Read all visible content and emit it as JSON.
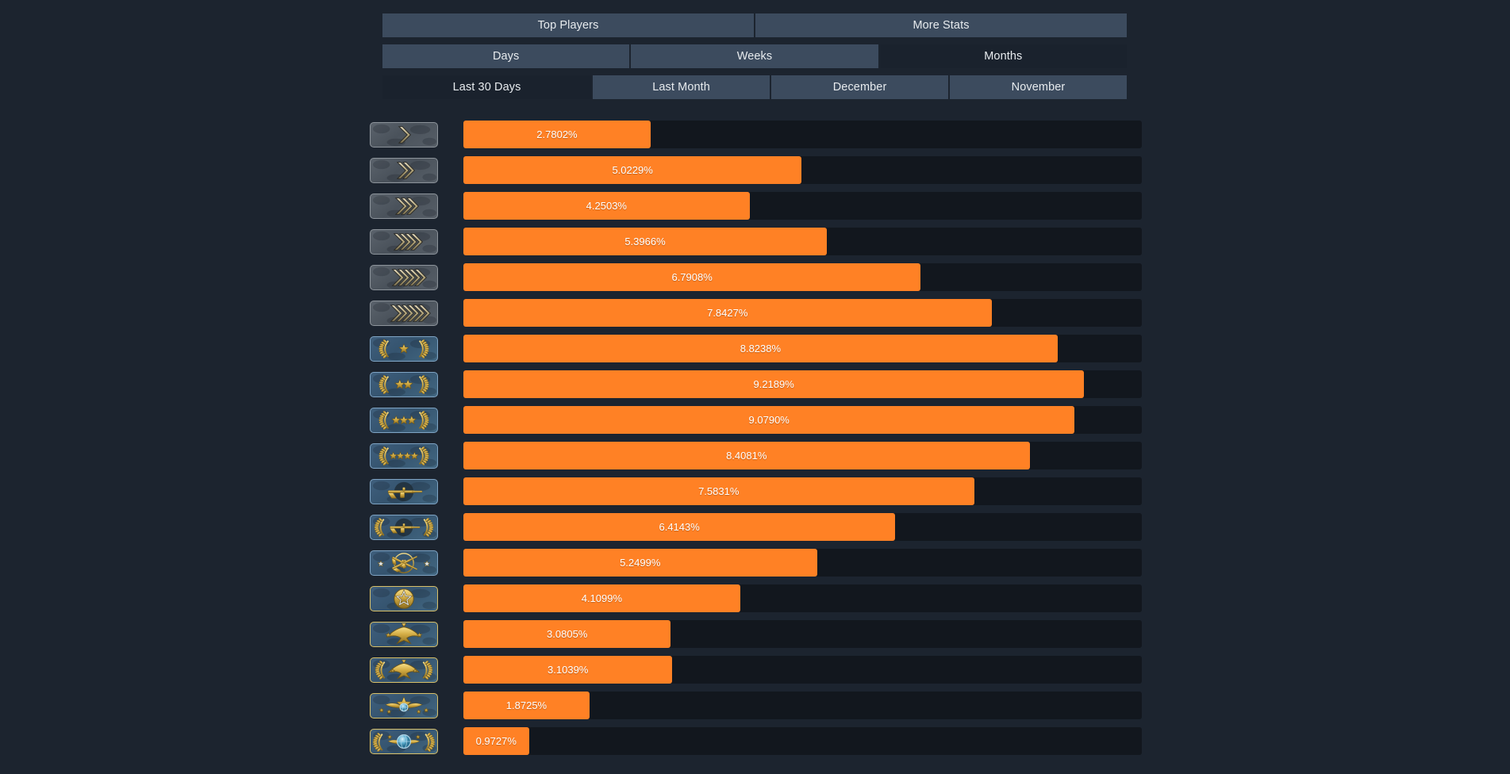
{
  "theme": {
    "page_background": "#1c242f",
    "tab_background": "#3c4b5e",
    "tab_active_background": "#1a222d",
    "track_background": "#12171e",
    "bar_color": "#ff8125",
    "text_color": "#e7ebee"
  },
  "tabs": {
    "primary": [
      {
        "label": "Top Players",
        "active": false
      },
      {
        "label": "More Stats",
        "active": false
      }
    ],
    "period": [
      {
        "label": "Days",
        "active": false
      },
      {
        "label": "Weeks",
        "active": false
      },
      {
        "label": "Months",
        "active": true
      }
    ],
    "range": [
      {
        "label": "Last 30 Days",
        "active": true
      },
      {
        "label": "Last Month",
        "active": false
      },
      {
        "label": "December",
        "active": false
      },
      {
        "label": "November",
        "active": false
      }
    ]
  },
  "chart_data": {
    "type": "bar",
    "orientation": "horizontal",
    "title": "",
    "xlabel": "",
    "ylabel": "",
    "xlim": [
      0,
      10
    ],
    "grid": false,
    "legend": false,
    "categories": [
      "Silver I",
      "Silver II",
      "Silver III",
      "Silver IV",
      "Silver Elite",
      "Silver Elite Master",
      "Gold Nova I",
      "Gold Nova II",
      "Gold Nova III",
      "Gold Nova Master",
      "Master Guardian I",
      "Master Guardian II",
      "Master Guardian Elite",
      "Distinguished Master Guardian",
      "Legendary Eagle",
      "Legendary Eagle Master",
      "Supreme Master First Class",
      "The Global Elite"
    ],
    "values": [
      2.7802,
      5.0229,
      4.2503,
      5.3966,
      6.7908,
      7.8427,
      8.8238,
      9.2189,
      9.079,
      8.4081,
      7.5831,
      6.4143,
      5.2499,
      4.1099,
      3.0805,
      3.1039,
      1.8725,
      0.9727
    ],
    "value_labels": [
      "2.7802%",
      "5.0229%",
      "4.2503%",
      "5.3966%",
      "6.7908%",
      "7.8427%",
      "8.8238%",
      "9.2189%",
      "9.0790%",
      "8.4081%",
      "7.5831%",
      "6.4143%",
      "5.2499%",
      "4.1099%",
      "3.0805%",
      "3.1039%",
      "1.8725%",
      "0.9727%"
    ],
    "badges": [
      {
        "icon": "chevron-1-icon",
        "style": "silver"
      },
      {
        "icon": "chevron-2-icon",
        "style": "silver"
      },
      {
        "icon": "chevron-3-icon",
        "style": "silver"
      },
      {
        "icon": "chevron-4-icon",
        "style": "silver"
      },
      {
        "icon": "chevron-5-icon",
        "style": "silver"
      },
      {
        "icon": "chevron-6-icon",
        "style": "silver"
      },
      {
        "icon": "wreath-star-1-icon",
        "style": "blue"
      },
      {
        "icon": "wreath-star-2-icon",
        "style": "blue"
      },
      {
        "icon": "wreath-star-3-icon",
        "style": "blue"
      },
      {
        "icon": "wreath-star-4-icon",
        "style": "blue"
      },
      {
        "icon": "rifle-1-icon",
        "style": "blue"
      },
      {
        "icon": "rifle-wreath-icon",
        "style": "blue"
      },
      {
        "icon": "crossed-rifles-icon",
        "style": "blue"
      },
      {
        "icon": "star-medal-icon",
        "style": "gold"
      },
      {
        "icon": "eagle-icon",
        "style": "gold"
      },
      {
        "icon": "eagle-wreath-icon",
        "style": "gold"
      },
      {
        "icon": "winged-star-icon",
        "style": "gold"
      },
      {
        "icon": "globe-wings-icon",
        "style": "gold"
      }
    ]
  }
}
